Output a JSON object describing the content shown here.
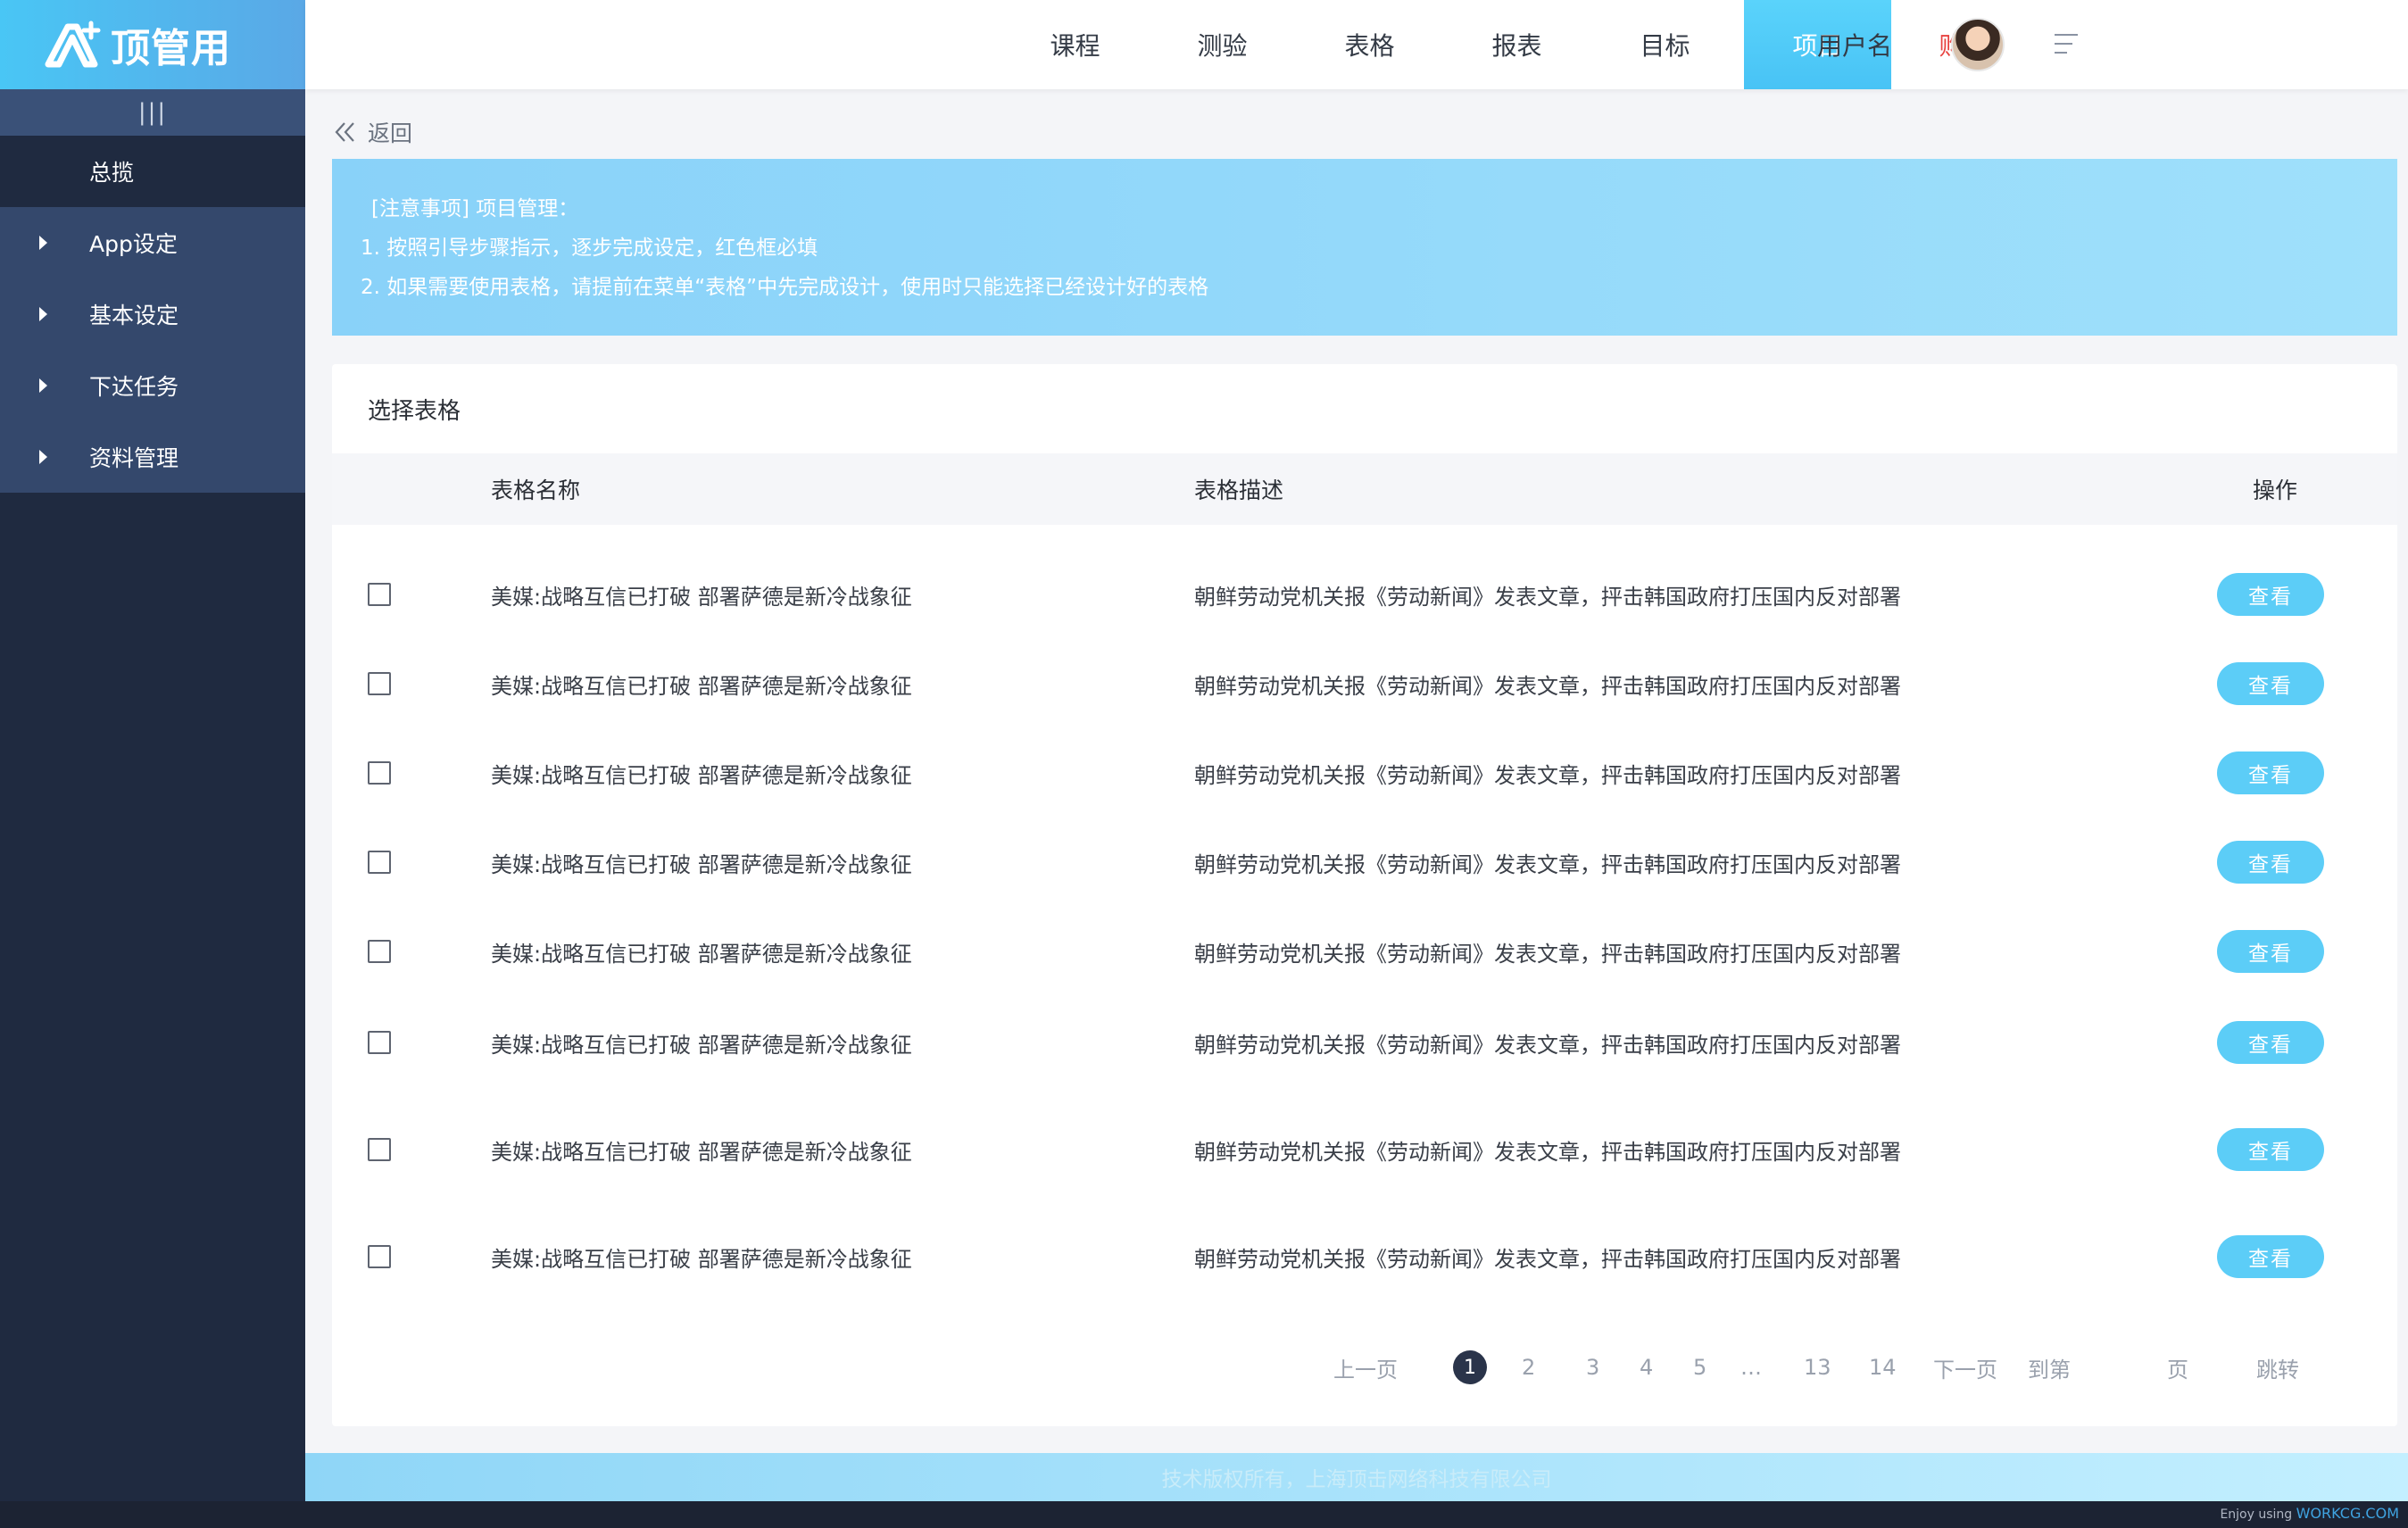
{
  "brand": {
    "name": "顶管用",
    "accent": "#49c6f5"
  },
  "sidebar": {
    "collapse_label": "|||",
    "overview": "总揽",
    "items": [
      {
        "label": "App设定"
      },
      {
        "label": "基本设定"
      },
      {
        "label": "下达任务"
      },
      {
        "label": "资料管理"
      }
    ]
  },
  "topnav": {
    "items": [
      {
        "label": "课程"
      },
      {
        "label": "测验"
      },
      {
        "label": "表格"
      },
      {
        "label": "报表"
      },
      {
        "label": "目标"
      },
      {
        "label": "项目",
        "active": true
      },
      {
        "label": "购买"
      }
    ],
    "username": "用户名"
  },
  "back_label": "返回",
  "notice": {
    "title": "[注意事项] 项目管理：",
    "line1": "1. 按照引导步骤指示，逐步完成设定，红色框必填",
    "line2": "2. 如果需要使用表格，请提前在菜单“表格”中先完成设计，使用时只能选择已经设计好的表格"
  },
  "card": {
    "title": "选择表格",
    "columns": {
      "name": "表格名称",
      "desc": "表格描述",
      "action": "操作"
    },
    "rows": [
      {
        "name": "美媒:战略互信已打破 部署萨德是新冷战象征",
        "desc": "朝鲜劳动党机关报《劳动新闻》发表文章，抨击韩国政府打压国内反对部署",
        "action": "查看"
      },
      {
        "name": "美媒:战略互信已打破 部署萨德是新冷战象征",
        "desc": "朝鲜劳动党机关报《劳动新闻》发表文章，抨击韩国政府打压国内反对部署",
        "action": "查看"
      },
      {
        "name": "美媒:战略互信已打破 部署萨德是新冷战象征",
        "desc": "朝鲜劳动党机关报《劳动新闻》发表文章，抨击韩国政府打压国内反对部署",
        "action": "查看"
      },
      {
        "name": "美媒:战略互信已打破 部署萨德是新冷战象征",
        "desc": "朝鲜劳动党机关报《劳动新闻》发表文章，抨击韩国政府打压国内反对部署",
        "action": "查看"
      },
      {
        "name": "美媒:战略互信已打破 部署萨德是新冷战象征",
        "desc": "朝鲜劳动党机关报《劳动新闻》发表文章，抨击韩国政府打压国内反对部署",
        "action": "查看"
      },
      {
        "name": "美媒:战略互信已打破 部署萨德是新冷战象征",
        "desc": "朝鲜劳动党机关报《劳动新闻》发表文章，抨击韩国政府打压国内反对部署",
        "action": "查看"
      },
      {
        "name": "美媒:战略互信已打破 部署萨德是新冷战象征",
        "desc": "朝鲜劳动党机关报《劳动新闻》发表文章，抨击韩国政府打压国内反对部署",
        "action": "查看"
      },
      {
        "name": "美媒:战略互信已打破 部署萨德是新冷战象征",
        "desc": "朝鲜劳动党机关报《劳动新闻》发表文章，抨击韩国政府打压国内反对部署",
        "action": "查看"
      }
    ]
  },
  "pagination": {
    "prev": "上一页",
    "pages": [
      "1",
      "2",
      "3",
      "4",
      "5"
    ],
    "current": "1",
    "ellipsis": "…",
    "tail_pages": [
      "13",
      "14"
    ],
    "next": "下一页",
    "goto_label": "到第",
    "page_unit": "页",
    "jump": "跳转"
  },
  "footer": {
    "copyright": "技术版权所有，上海顶击网络科技有限公司"
  },
  "watermark": {
    "prefix": "Enjoy using",
    "site": "WORKCG.COM"
  }
}
